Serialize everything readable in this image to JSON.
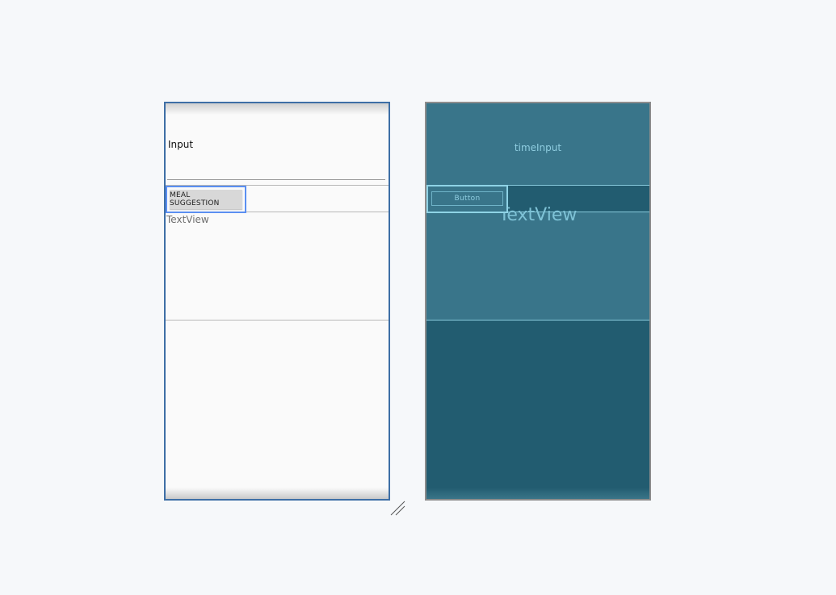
{
  "design_view": {
    "input_label": "Input",
    "button_label": "MEAL SUGGESTION",
    "textview_label": "TextView"
  },
  "blueprint_view": {
    "input_label": "timeInput",
    "button_label": "Button",
    "textview_label": "TextView"
  },
  "colors": {
    "canvas_background": "#f6f8fa",
    "design_border": "#3e6fa6",
    "selection_highlight": "#5b8ff1",
    "blueprint_background": "#225c70",
    "blueprint_widget": "#39758a",
    "blueprint_text": "#8fcde0"
  },
  "icons": {
    "resize_handle": "resize-handle-icon"
  }
}
